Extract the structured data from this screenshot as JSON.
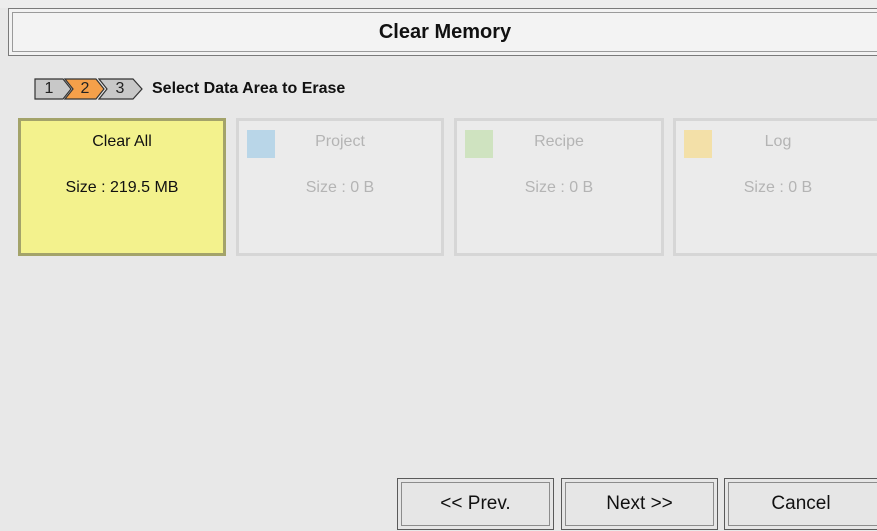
{
  "window": {
    "title": "Clear Memory"
  },
  "wizard": {
    "steps": [
      "1",
      "2",
      "3"
    ],
    "current_step": 2,
    "step_label": "Select Data Area to Erase"
  },
  "cards": [
    {
      "name": "Clear All",
      "size": "Size : 219.5 MB",
      "color": "#f3f28d",
      "selected": true,
      "enabled": true
    },
    {
      "name": "Project",
      "size": "Size : 0 B",
      "color": "#b9d6e8",
      "selected": false,
      "enabled": false
    },
    {
      "name": "Recipe",
      "size": "Size : 0 B",
      "color": "#cfe3c0",
      "selected": false,
      "enabled": false
    },
    {
      "name": "Log",
      "size": "Size : 0 B",
      "color": "#f3e0a8",
      "selected": false,
      "enabled": false
    }
  ],
  "buttons": {
    "prev_label": "<< Prev.",
    "next_label": "Next >>",
    "cancel_label": "Cancel"
  },
  "colors": {
    "active_step": "#f5a04a",
    "inactive_step": "#c8c8c8",
    "background": "#e8e8e8"
  }
}
